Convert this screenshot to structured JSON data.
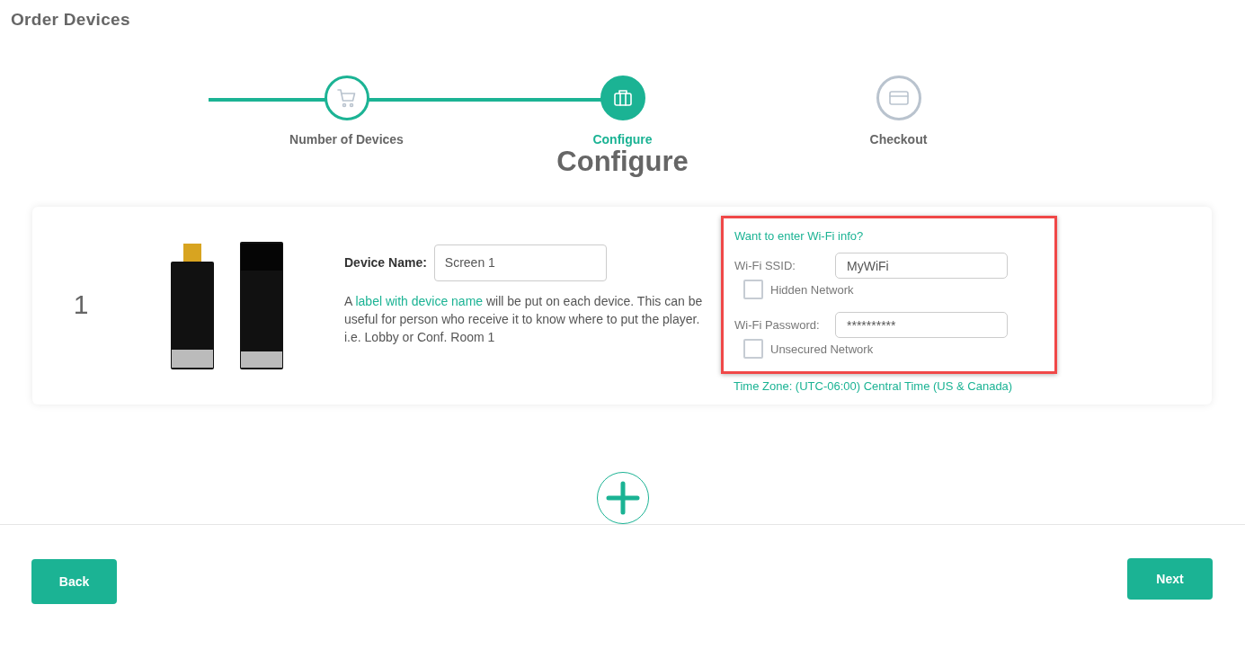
{
  "page_title": "Order Devices",
  "steps": [
    {
      "label": "Number of Devices",
      "kind": "cart",
      "completed": true,
      "selected": false
    },
    {
      "label": "Configure",
      "kind": "briefcase",
      "completed": true,
      "selected": true
    },
    {
      "label": "Checkout",
      "kind": "card",
      "completed": false,
      "selected": false
    }
  ],
  "heading": "Configure",
  "devices": [
    {
      "number": "1",
      "name_label": "Device Name:",
      "name_value": "Screen 1",
      "note_before": "A ",
      "note_link": "label with device name",
      "note_after": " will be put on each device. This can be useful for person who receive it to know where to put the player. i.e. Lobby or Conf. Room 1",
      "wifi": {
        "prompt": "Want to enter Wi-Fi info?",
        "ssid_label": "Wi-Fi SSID:",
        "ssid_value": "MyWiFi",
        "hidden": {
          "label": "Hidden Network",
          "checked": false
        },
        "password_label": "Wi-Fi Password:",
        "password_value": "**********",
        "unsecured": {
          "label": "Unsecured Network",
          "checked": false
        }
      },
      "time_zone": "Time Zone: (UTC-06:00) Central Time (US & Canada)"
    }
  ],
  "back_button": "Back",
  "next_button": "Next"
}
